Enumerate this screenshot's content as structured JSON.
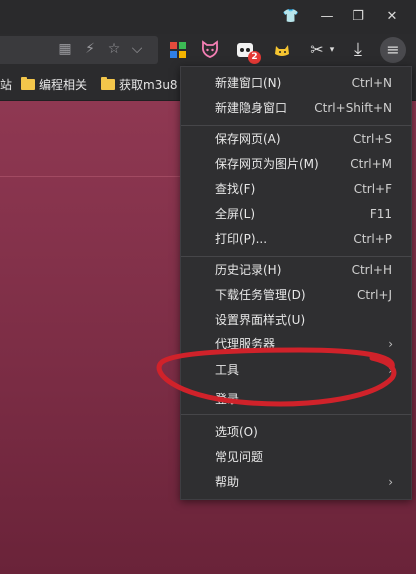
{
  "bookmarks": {
    "partial_item": "站",
    "items": [
      "编程相关",
      "获取m3u8"
    ]
  },
  "menu": {
    "groups": [
      [
        {
          "label": "新建窗口(N)",
          "shortcut": "Ctrl+N"
        },
        {
          "label": "新建隐身窗口",
          "shortcut": "Ctrl+Shift+N"
        }
      ],
      [
        {
          "label": "保存网页(A)",
          "shortcut": "Ctrl+S"
        },
        {
          "label": "保存网页为图片(M)",
          "shortcut": "Ctrl+M"
        },
        {
          "label": "查找(F)",
          "shortcut": "Ctrl+F"
        },
        {
          "label": "全屏(L)",
          "shortcut": "F11"
        },
        {
          "label": "打印(P)...",
          "shortcut": "Ctrl+P"
        }
      ],
      [
        {
          "label": "历史记录(H)",
          "shortcut": "Ctrl+H"
        },
        {
          "label": "下载任务管理(D)",
          "shortcut": "Ctrl+J"
        },
        {
          "label": "设置界面样式(U)",
          "shortcut": ""
        },
        {
          "label": "代理服务器",
          "shortcut": "",
          "submenu": true
        },
        {
          "label": "工具",
          "shortcut": "",
          "submenu": true
        },
        {
          "label": "登录",
          "shortcut": ""
        }
      ],
      [
        {
          "label": "选项(O)",
          "shortcut": ""
        },
        {
          "label": "常见问题",
          "shortcut": ""
        },
        {
          "label": "帮助",
          "shortcut": "",
          "submenu": true
        }
      ]
    ]
  },
  "toolbar": {
    "notification_count": "2"
  },
  "icons": {
    "submenu_arrow": "›",
    "minimize": "—",
    "restore": "❐",
    "close": "✕",
    "skin": "👕",
    "qr": "▦",
    "lightning": "⚡",
    "star": "☆",
    "chevron": "⌵",
    "download": "⤓",
    "scissors": "✂",
    "menu": "≡"
  },
  "colors": {
    "annotation": "#d0222a",
    "page_background": "#8f3852",
    "menu_background": "#2f2f31"
  }
}
